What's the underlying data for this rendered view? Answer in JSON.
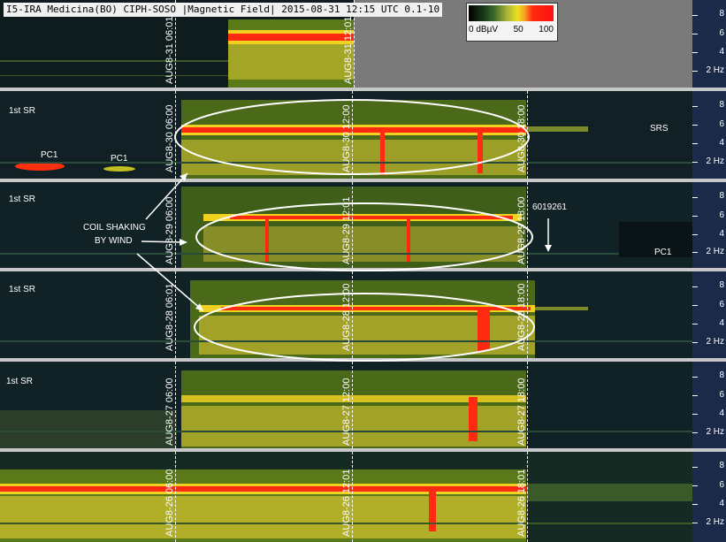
{
  "title": "I5-IRA Medicina(BO) CIPH-SOSO |Magnetic Field| 2015-08-31 12:15 UTC 0.1-10",
  "legend": {
    "labels": [
      "0 dBµV",
      "50",
      "100"
    ]
  },
  "axis_ticks": [
    "8",
    "6",
    "4",
    "2 Hz"
  ],
  "strips": [
    {
      "labels": [
        "AUG8-31 06:01",
        "AUG8-31 12:01"
      ]
    },
    {
      "labels": [
        "AUG8-30 06:00",
        "AUG8-30 12:00",
        "AUG8-30 18:00"
      ]
    },
    {
      "labels": [
        "AUG8-29 06:00",
        "AUG8-29 12:01",
        "AUG8-29 18:00"
      ]
    },
    {
      "labels": [
        "AUG8-28 06:01",
        "AUG8-28 12:00",
        "AUG8-28 18:00"
      ]
    },
    {
      "labels": [
        "AUG8-27 06:00",
        "AUG8-27 12:00",
        "AUG8-27 18:00"
      ]
    },
    {
      "labels": [
        "AUG8-26 06:00",
        "AUG8-26 12:01",
        "AUG8-26 18:01"
      ]
    }
  ],
  "annotations": {
    "sr1": "1st SR",
    "sr2": "1st SR",
    "sr3": "1st SR",
    "sr4": "1st SR",
    "pc1_a": "PC1",
    "pc1_b": "PC1",
    "pc1_c": "PC1",
    "srs": "SRS",
    "coil_line1": "COIL SHAKING",
    "coil_line2": "BY WIND",
    "event_id": "6019261"
  },
  "colors": {
    "red": "#ff2010",
    "yellow": "#f0e020",
    "green": "#5a8a2a",
    "background": "#0e1a1f",
    "axis": "#1c2a4a"
  }
}
